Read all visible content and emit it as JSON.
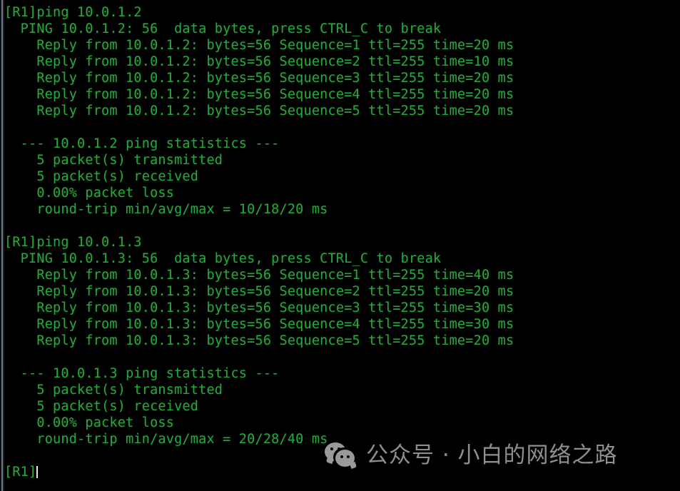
{
  "terminal": {
    "prompt": "[R1]",
    "foreground_color": "#24a83a",
    "background_color": "#000000",
    "cursor_color": "#e8e8e8",
    "lines": [
      "[R1]ping 10.0.1.2",
      "  PING 10.0.1.2: 56  data bytes, press CTRL_C to break",
      "    Reply from 10.0.1.2: bytes=56 Sequence=1 ttl=255 time=20 ms",
      "    Reply from 10.0.1.2: bytes=56 Sequence=2 ttl=255 time=10 ms",
      "    Reply from 10.0.1.2: bytes=56 Sequence=3 ttl=255 time=20 ms",
      "    Reply from 10.0.1.2: bytes=56 Sequence=4 ttl=255 time=20 ms",
      "    Reply from 10.0.1.2: bytes=56 Sequence=5 ttl=255 time=20 ms",
      "",
      "  --- 10.0.1.2 ping statistics ---",
      "    5 packet(s) transmitted",
      "    5 packet(s) received",
      "    0.00% packet loss",
      "    round-trip min/avg/max = 10/18/20 ms",
      "",
      "[R1]ping 10.0.1.3",
      "  PING 10.0.1.3: 56  data bytes, press CTRL_C to break",
      "    Reply from 10.0.1.3: bytes=56 Sequence=1 ttl=255 time=40 ms",
      "    Reply from 10.0.1.3: bytes=56 Sequence=2 ttl=255 time=20 ms",
      "    Reply from 10.0.1.3: bytes=56 Sequence=3 ttl=255 time=30 ms",
      "    Reply from 10.0.1.3: bytes=56 Sequence=4 ttl=255 time=30 ms",
      "    Reply from 10.0.1.3: bytes=56 Sequence=5 ttl=255 time=20 ms",
      "",
      "  --- 10.0.1.3 ping statistics ---",
      "    5 packet(s) transmitted",
      "    5 packet(s) received",
      "    0.00% packet loss",
      "    round-trip min/avg/max = 20/28/40 ms",
      ""
    ],
    "sessions": [
      {
        "command": "ping 10.0.1.2",
        "target": "10.0.1.2",
        "data_bytes": 56,
        "break_hint": "press CTRL_C to break",
        "replies": [
          {
            "from": "10.0.1.2",
            "bytes": 56,
            "sequence": 1,
            "ttl": 255,
            "time_ms": 20
          },
          {
            "from": "10.0.1.2",
            "bytes": 56,
            "sequence": 2,
            "ttl": 255,
            "time_ms": 10
          },
          {
            "from": "10.0.1.2",
            "bytes": 56,
            "sequence": 3,
            "ttl": 255,
            "time_ms": 20
          },
          {
            "from": "10.0.1.2",
            "bytes": 56,
            "sequence": 4,
            "ttl": 255,
            "time_ms": 20
          },
          {
            "from": "10.0.1.2",
            "bytes": 56,
            "sequence": 5,
            "ttl": 255,
            "time_ms": 20
          }
        ],
        "statistics": {
          "header": "--- 10.0.1.2 ping statistics ---",
          "transmitted": "5 packet(s) transmitted",
          "received": "5 packet(s) received",
          "loss": "0.00% packet loss",
          "round_trip": "round-trip min/avg/max = 10/18/20 ms",
          "min_ms": 10,
          "avg_ms": 18,
          "max_ms": 20
        }
      },
      {
        "command": "ping 10.0.1.3",
        "target": "10.0.1.3",
        "data_bytes": 56,
        "break_hint": "press CTRL_C to break",
        "replies": [
          {
            "from": "10.0.1.3",
            "bytes": 56,
            "sequence": 1,
            "ttl": 255,
            "time_ms": 40
          },
          {
            "from": "10.0.1.3",
            "bytes": 56,
            "sequence": 2,
            "ttl": 255,
            "time_ms": 20
          },
          {
            "from": "10.0.1.3",
            "bytes": 56,
            "sequence": 3,
            "ttl": 255,
            "time_ms": 30
          },
          {
            "from": "10.0.1.3",
            "bytes": 56,
            "sequence": 4,
            "ttl": 255,
            "time_ms": 30
          },
          {
            "from": "10.0.1.3",
            "bytes": 56,
            "sequence": 5,
            "ttl": 255,
            "time_ms": 20
          }
        ],
        "statistics": {
          "header": "--- 10.0.1.3 ping statistics ---",
          "transmitted": "5 packet(s) transmitted",
          "received": "5 packet(s) received",
          "loss": "0.00% packet loss",
          "round_trip": "round-trip min/avg/max = 20/28/40 ms",
          "min_ms": 20,
          "avg_ms": 28,
          "max_ms": 40
        }
      }
    ]
  },
  "watermark": {
    "icon": "wechat-icon",
    "text": "公众号 · 小白的网络之路",
    "color": "#8e8e8e"
  }
}
